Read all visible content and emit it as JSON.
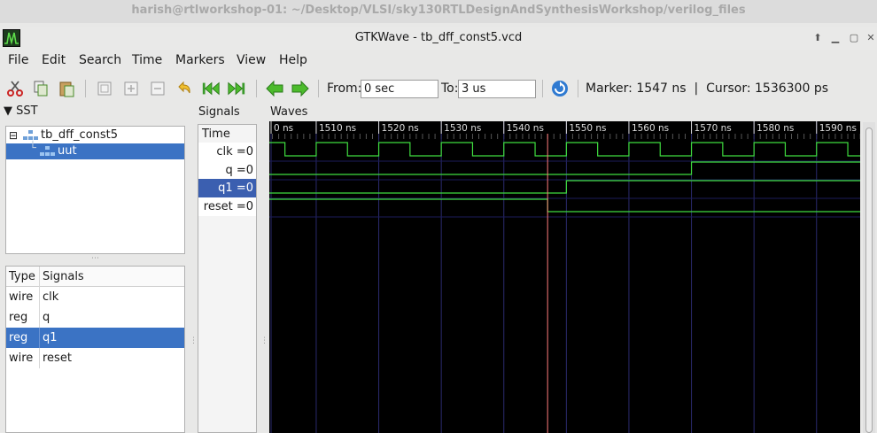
{
  "desktop_title": "harish@rtlworkshop-01: ~/Desktop/VLSI/sky130RTLDesignAndSynthesisWorkshop/verilog_files",
  "window_title": "GTKWave - tb_dff_const5.vcd",
  "menu": [
    "File",
    "Edit",
    "Search",
    "Time",
    "Markers",
    "View",
    "Help"
  ],
  "toolbar": {
    "from_label": "From:",
    "from_value": "0 sec",
    "to_label": "To:",
    "to_value": "3 us",
    "status": "Marker: 1547 ns  |  Cursor: 1536300 ps"
  },
  "sst": {
    "header": "SST",
    "tree": [
      {
        "label": "tb_dff_const5",
        "level": 0,
        "expanded": true
      },
      {
        "label": "uut",
        "level": 1,
        "selected": true
      }
    ],
    "table_headers": [
      "Type",
      "Signals"
    ],
    "rows": [
      {
        "type": "wire",
        "name": "clk"
      },
      {
        "type": "reg",
        "name": "q"
      },
      {
        "type": "reg",
        "name": "q1",
        "selected": true
      },
      {
        "type": "wire",
        "name": "reset"
      }
    ]
  },
  "signals": {
    "header": "Signals",
    "time_label": "Time",
    "items": [
      {
        "label": "clk =0"
      },
      {
        "label": "q =0"
      },
      {
        "label": "q1 =0",
        "selected": true
      },
      {
        "label": "reset =0"
      }
    ]
  },
  "waves": {
    "header": "Waves",
    "tick_labels": [
      "0 ns",
      "1510 ns",
      "1520 ns",
      "1530 ns",
      "1540 ns",
      "1550 ns",
      "1560 ns",
      "1570 ns",
      "1580 ns",
      "1590 ns"
    ],
    "view_start_ns": 1502.5,
    "ns_per_div": 10,
    "marker_ns": 1547,
    "clk_edges_ns": [
      1505,
      1510,
      1515,
      1520,
      1525,
      1530,
      1535,
      1540,
      1545,
      1550,
      1555,
      1560,
      1565,
      1570,
      1575,
      1580,
      1585,
      1590,
      1595
    ],
    "clk_initial": 1,
    "q_rise_ns": 1570,
    "q1_rise_ns": 1550,
    "reset_fall_ns": 1547
  },
  "colors": {
    "wave_green": "#3fdc3f",
    "marker": "#ff7a7a",
    "selection": "#3b73c4",
    "grid": "#2a2a6e"
  },
  "icons": [
    "cut-icon",
    "copy-icon",
    "paste-icon",
    "zoom-fit-icon",
    "zoom-in-icon",
    "zoom-out-icon",
    "undo-icon",
    "jump-start-icon",
    "jump-end-icon",
    "prev-icon",
    "next-icon",
    "reload-icon"
  ]
}
